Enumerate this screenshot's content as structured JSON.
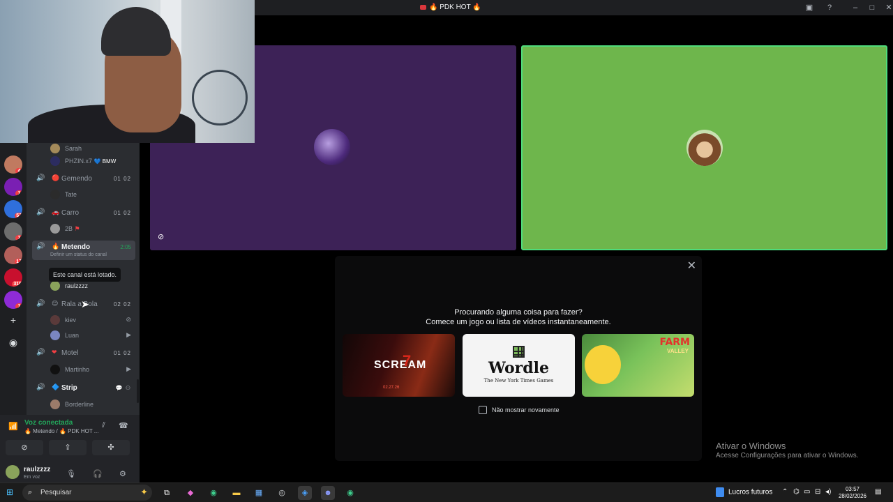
{
  "window": {
    "title": "🔥 PDK HOT 🔥"
  },
  "servers": [
    {
      "badge": "4"
    },
    {
      "badge": "1"
    },
    {
      "badge": "53"
    },
    {
      "badge": "1"
    },
    {
      "badge": "17"
    },
    {
      "badge": "319"
    },
    {
      "badge": "1"
    }
  ],
  "channels": [
    {
      "emoji": "🔴",
      "name": "Gemendo",
      "count": "01 02"
    },
    {
      "emoji": "🚗",
      "name": "Carro",
      "count": "01 02"
    },
    {
      "emoji": "🔥",
      "name": "Metendo",
      "time": "2:05",
      "status": "Definir um status do canal"
    },
    {
      "emoji": "😊",
      "name": "Rala a Bola",
      "count": "02 02"
    },
    {
      "emoji": "❤",
      "name": "Motel",
      "count": "01 02"
    },
    {
      "emoji": "🔷",
      "name": "Strip"
    }
  ],
  "members": {
    "sarah": "Sarah",
    "phzin": "PHZIN.x7",
    "phzin_tag": "BMW",
    "tate": "Tate",
    "twob": "2B",
    "raulzzzz": "raulzzzz",
    "kiev": "kiev",
    "luan": "Luan",
    "martinho": "Martinho",
    "borderline": "Borderline"
  },
  "tooltip": "Este canal está lotado.",
  "voice": {
    "status": "Voz conectada",
    "location": "🔥 Metendo / 🔥 PDK HOT ..."
  },
  "user": {
    "name": "raulzzzz",
    "status": "Em voz"
  },
  "activity_modal": {
    "heading1": "Procurando alguma coisa para fazer?",
    "heading2": "Comece um jogo ou lista de vídeos instantaneamente.",
    "games": [
      {
        "title": "SCREAM",
        "number": "7",
        "date": "02.27.26"
      },
      {
        "title": "Wordle",
        "byline": "The New York Times Games"
      },
      {
        "title": "FARM",
        "subtitle": "VALLEY"
      }
    ],
    "checkbox_label": "Não mostrar novamente"
  },
  "watermark": {
    "line1": "Ativar o Windows",
    "line2": "Acesse Configurações para ativar o Windows."
  },
  "taskbar": {
    "search_placeholder": "Pesquisar",
    "weather": "Lucros futuros",
    "time": "03:57",
    "date": "28/02/2026"
  },
  "colors": {
    "accent_green": "#23a55a",
    "tile_purple": "#3d2257",
    "tile_green": "#6eb64c",
    "badge_red": "#f23f43"
  }
}
